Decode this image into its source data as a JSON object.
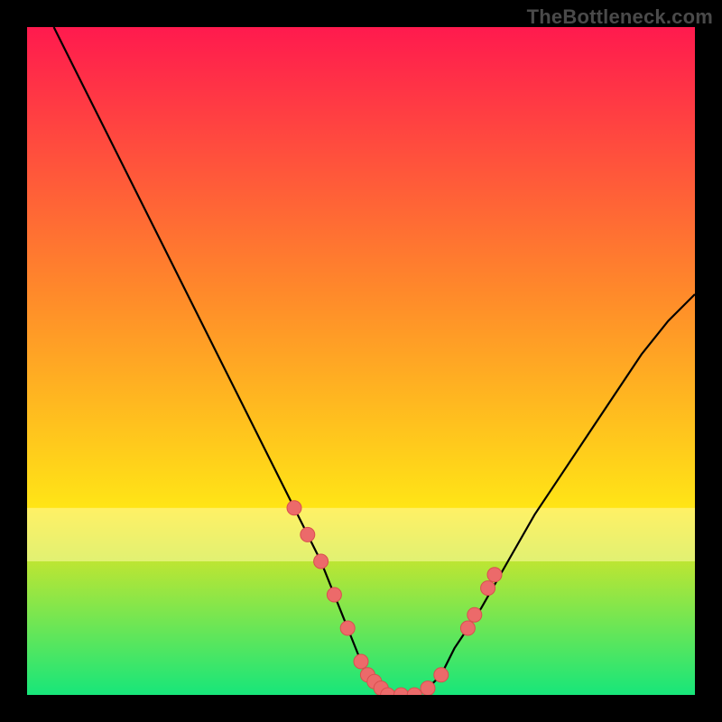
{
  "watermark": "TheBottleneck.com",
  "colors": {
    "gradient_top": "#ff1a4e",
    "gradient_upper_mid": "#ff8a2a",
    "gradient_lower_mid": "#ffe516",
    "gradient_bottom": "#17e67a",
    "background": "#000000",
    "curve": "#000000",
    "highlight_band": "#fffca8",
    "dot_fill": "#ec6a6a",
    "dot_stroke": "#d94f4f"
  },
  "chart_data": {
    "type": "line",
    "title": "",
    "xlabel": "",
    "ylabel": "",
    "xlim": [
      0,
      100
    ],
    "ylim": [
      0,
      100
    ],
    "grid": false,
    "legend": false,
    "series": [
      {
        "name": "bottleneck-curve",
        "x": [
          4,
          8,
          12,
          16,
          20,
          24,
          28,
          32,
          36,
          40,
          42,
          44,
          46,
          48,
          50,
          52,
          54,
          56,
          58,
          60,
          62,
          64,
          68,
          72,
          76,
          80,
          84,
          88,
          92,
          96,
          100
        ],
        "y": [
          100,
          92,
          84,
          76,
          68,
          60,
          52,
          44,
          36,
          28,
          24,
          20,
          15,
          10,
          5,
          2,
          0,
          0,
          0,
          1,
          3,
          7,
          13,
          20,
          27,
          33,
          39,
          45,
          51,
          56,
          60
        ]
      }
    ],
    "dots": [
      {
        "x": 40,
        "y": 28
      },
      {
        "x": 42,
        "y": 24
      },
      {
        "x": 44,
        "y": 20
      },
      {
        "x": 46,
        "y": 15
      },
      {
        "x": 48,
        "y": 10
      },
      {
        "x": 50,
        "y": 5
      },
      {
        "x": 51,
        "y": 3
      },
      {
        "x": 52,
        "y": 2
      },
      {
        "x": 53,
        "y": 1
      },
      {
        "x": 54,
        "y": 0
      },
      {
        "x": 56,
        "y": 0
      },
      {
        "x": 58,
        "y": 0
      },
      {
        "x": 60,
        "y": 1
      },
      {
        "x": 62,
        "y": 3
      },
      {
        "x": 66,
        "y": 10
      },
      {
        "x": 67,
        "y": 12
      },
      {
        "x": 69,
        "y": 16
      },
      {
        "x": 70,
        "y": 18
      }
    ],
    "highlight_band_y": [
      20,
      28
    ]
  }
}
